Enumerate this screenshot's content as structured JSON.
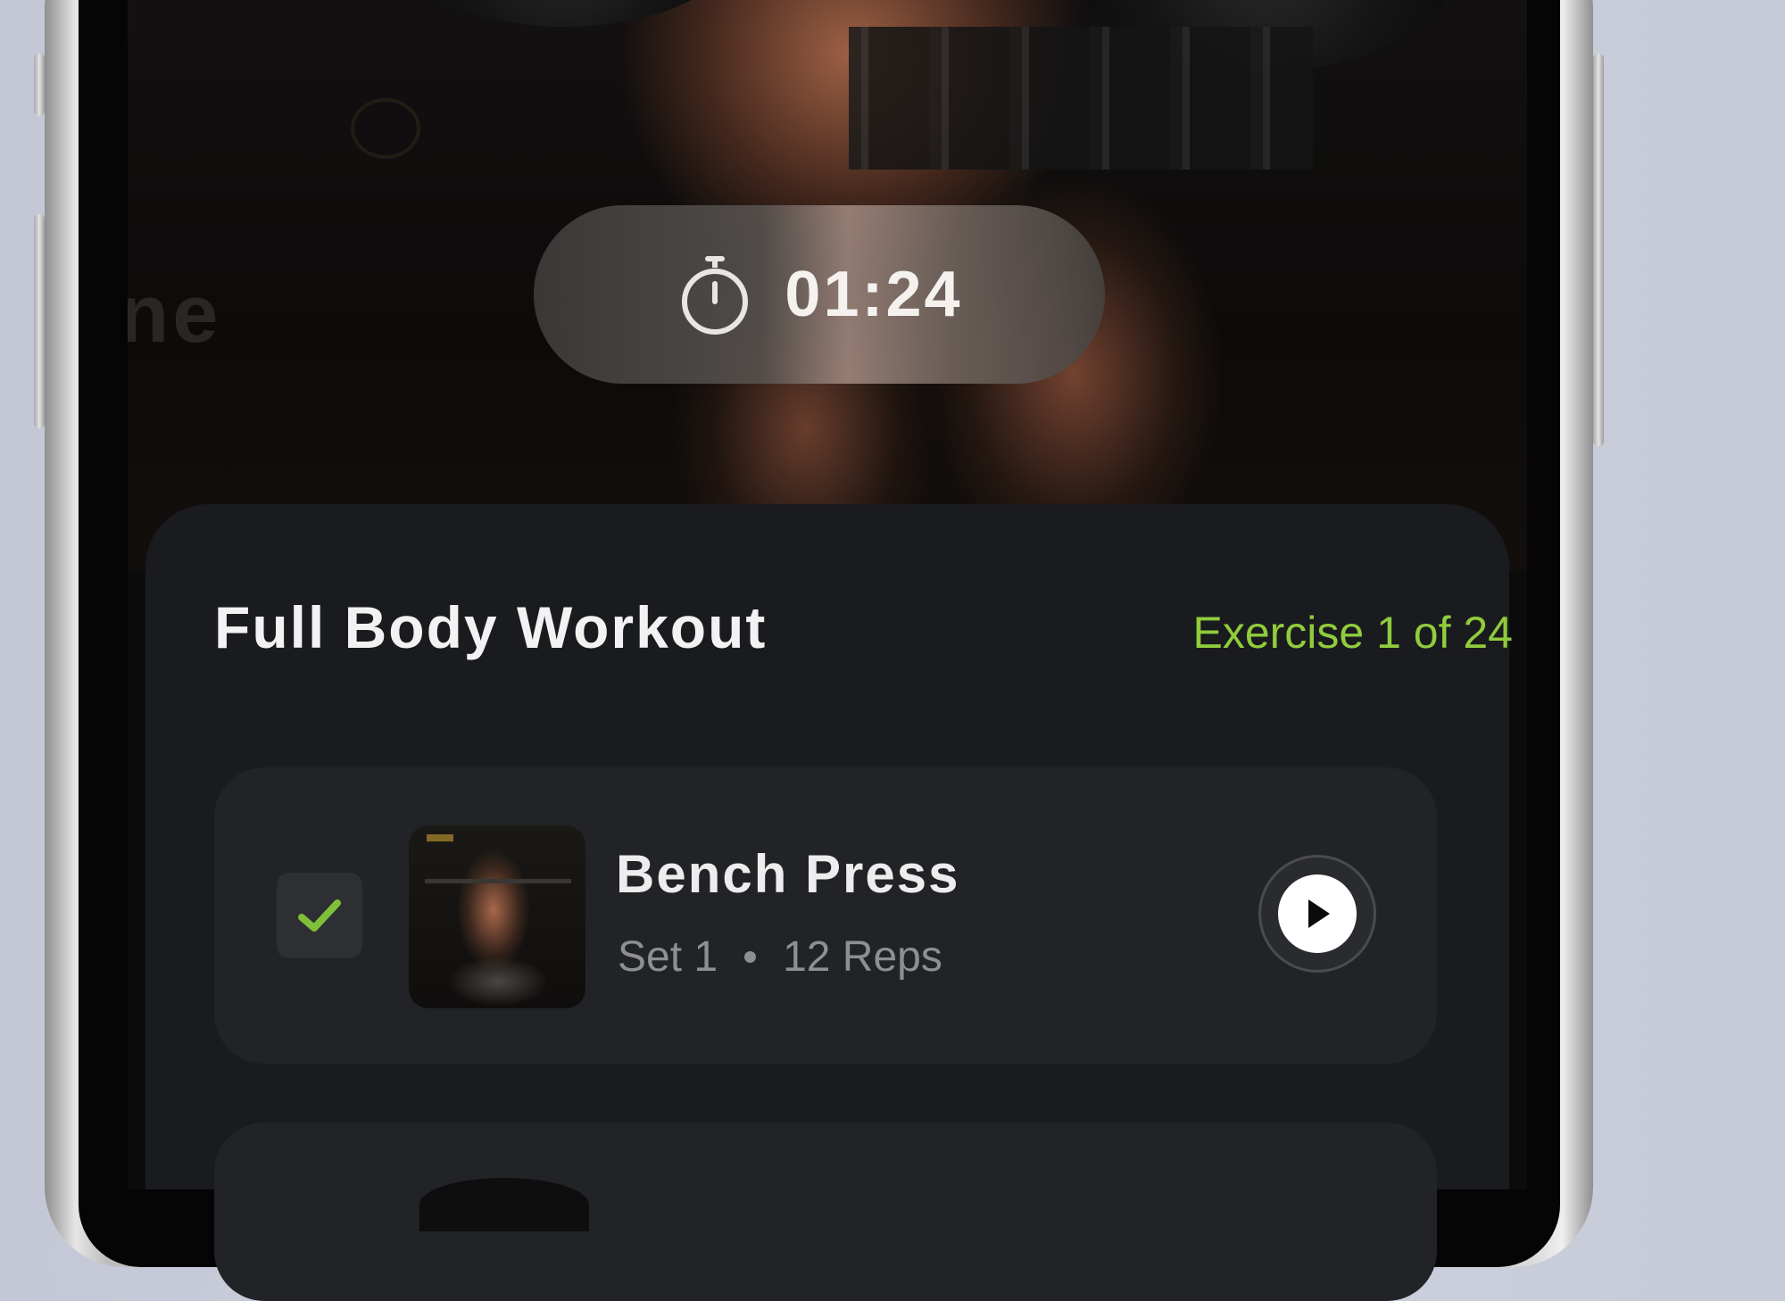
{
  "timer": {
    "value": "01:24"
  },
  "workout": {
    "title": "Full Body Workout",
    "progress_label": "Exercise 1 of 24"
  },
  "exercises": [
    {
      "name": "Bench Press",
      "set_label": "Set 1",
      "reps_label": "12 Reps",
      "completed": true
    }
  ],
  "hero": {
    "ghost_text": "ne"
  },
  "colors": {
    "accent_green": "#90cc3c",
    "sheet_bg": "#1a1b1e",
    "card_bg": "#222327"
  },
  "icons": {
    "timer": "stopwatch-icon",
    "check": "checkmark-icon",
    "play": "play-icon"
  }
}
